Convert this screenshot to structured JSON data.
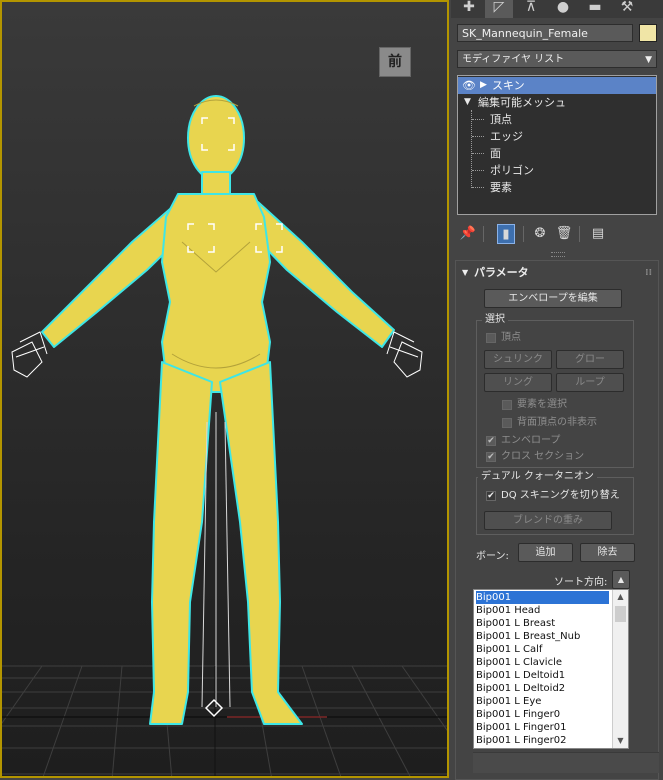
{
  "viewport": {
    "viewcube_label": "前"
  },
  "panel": {
    "object_name": "SK_Mannequin_Female",
    "object_color": "#f0e5a6",
    "modifier_list_label": "モディファイヤ リスト",
    "stack": {
      "skin_label": "スキン",
      "editable_mesh_label": "編集可能メッシュ",
      "sub_items": [
        "頂点",
        "エッジ",
        "面",
        "ポリゴン",
        "要素"
      ]
    },
    "parameters": {
      "title": "パラメータ",
      "edit_envelope": "エンベロープを編集",
      "select_group": "選択",
      "vertex_label": "頂点",
      "shrink": "シュリンク",
      "grow": "グロー",
      "ring": "リング",
      "loop": "ループ",
      "select_element": "要素を選択",
      "hide_backface": "背面頂点の非表示",
      "envelope": "エンベロープ",
      "cross_section": "クロス セクション",
      "dq_group": "デュアル クォータニオン",
      "dq_toggle": "DQ スキニングを切り替え",
      "blend_weight": "ブレンドの重み",
      "bones_label": "ボーン:",
      "add": "追加",
      "remove": "除去",
      "sort_label": "ソート方向:",
      "bones": [
        "Bip001",
        "Bip001 Head",
        "Bip001 L Breast",
        "Bip001 L Breast_Nub",
        "Bip001 L Calf",
        "Bip001 L Clavicle",
        "Bip001 L Deltoid1",
        "Bip001 L Deltoid2",
        "Bip001 L Eye",
        "Bip001 L Finger0",
        "Bip001 L Finger01",
        "Bip001 L Finger02"
      ]
    }
  }
}
